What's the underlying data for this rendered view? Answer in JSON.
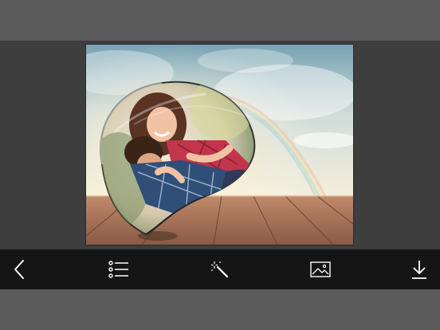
{
  "toolbar": {
    "items": [
      {
        "id": "back",
        "icon": "back-arrow-icon"
      },
      {
        "id": "frames",
        "icon": "list-icon"
      },
      {
        "id": "effects",
        "icon": "magic-wand-icon"
      },
      {
        "id": "gallery",
        "icon": "image-icon"
      },
      {
        "id": "save",
        "icon": "download-icon"
      }
    ]
  },
  "canvas": {
    "photo": "couple-in-bubble-frame-image",
    "colors": {
      "sky_top": "#6f9eb3",
      "sky_mid": "#dfe9e6",
      "sun_glow": "#fff6d8",
      "deck": "#b0775a",
      "deck_dark": "#7c4f3c"
    }
  },
  "colors": {
    "top_bar": "#5a5a5a",
    "stage": "#3e3e3e",
    "toolbar": "#151515",
    "icon": "#ffffff"
  }
}
